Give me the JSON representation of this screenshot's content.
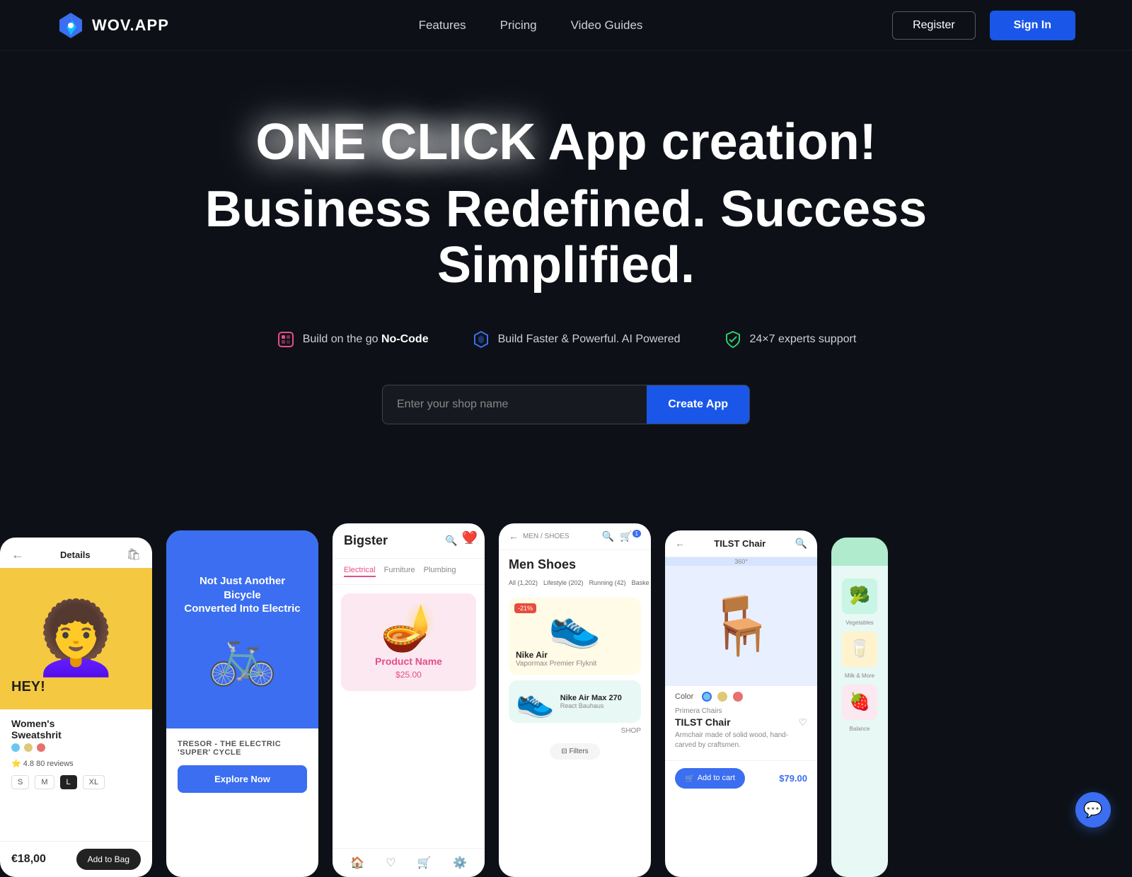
{
  "nav": {
    "logo_text": "WOV.APP",
    "links": [
      {
        "label": "Features",
        "id": "features"
      },
      {
        "label": "Pricing",
        "id": "pricing"
      },
      {
        "label": "Video Guides",
        "id": "video-guides"
      }
    ],
    "register_label": "Register",
    "signin_label": "Sign In"
  },
  "hero": {
    "line1_highlight": "ONE CLICK",
    "line1_rest": " App creation!",
    "line2": "Business Redefined. Success",
    "line3": "Simplified."
  },
  "badges": [
    {
      "icon": "⬡",
      "text": "Build on the go ",
      "bold": "No-Code",
      "color": "#e74c8b"
    },
    {
      "icon": "⬡",
      "text": "Build Faster & Powerful. AI Powered",
      "bold": "",
      "color": "#3b6ef0"
    },
    {
      "icon": "⬡",
      "text": "24×7 experts support",
      "bold": "",
      "color": "#2ecc71"
    }
  ],
  "cta": {
    "placeholder": "Enter your shop name",
    "button_label": "Create App"
  },
  "cards": {
    "fashion": {
      "header": "Details",
      "model_emoji": "👩",
      "hey_text": "HEY!",
      "name": "Women's\nSweatshrit",
      "colors": [
        "#6ec6f0",
        "#e0c87a",
        "#e87070"
      ],
      "rating": "⭐ 4.8  80 reviews",
      "sizes": [
        "S",
        "M",
        "L",
        "XL"
      ],
      "active_size": "L",
      "price": "€18,00",
      "add_to_bag": "Add to Bag"
    },
    "bike": {
      "headline": "Not Just Another Bicycle\nConverted Into Electric",
      "emoji": "🚲",
      "name": "TRESOR - THE ELECTRIC 'SUPER' CYCLE",
      "explore_btn": "Explore Now"
    },
    "store": {
      "logo": "Bigster",
      "categories": [
        "Electrical",
        "Furniture",
        "Plumbing"
      ],
      "active_cat": "Electrical",
      "product_img": "🪔",
      "product_name": "Product Name",
      "product_price": "$25.00"
    },
    "shoes": {
      "breadcrumb": "MEN / SHOES",
      "section": "Men Shoes",
      "filters": [
        "All (1,202)",
        "Lifestyle (202)",
        "Running (42)",
        "Baske"
      ],
      "product1": {
        "badge": "-21%",
        "emoji": "👟",
        "name": "Nike Air",
        "sub": "Vapormax Premier Flyknit"
      },
      "product2": {
        "emoji": "👟",
        "name": "Nike Air Max 270",
        "sub": "React Bauhaus"
      }
    },
    "chair": {
      "header": "TILST Chair",
      "emoji": "🪑",
      "colors": [
        "#6ec6f0",
        "#e0c87a",
        "#e87070"
      ],
      "brand": "Primera Chairs",
      "name": "TILST Chair",
      "desc": "Armchair made of solid wood, hand-carved by craftsmen.",
      "cart_btn": "Add to cart",
      "price": "$79.00"
    }
  }
}
